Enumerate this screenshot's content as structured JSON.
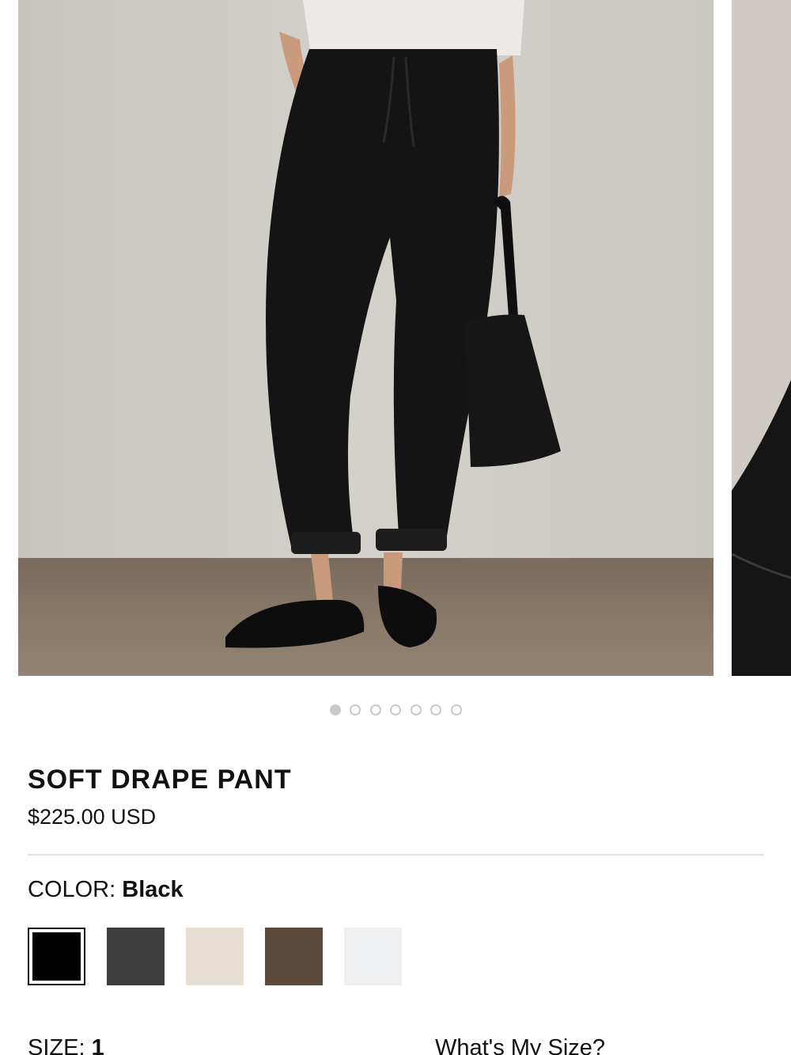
{
  "product": {
    "title": "SOFT DRAPE PANT",
    "price": "$225.00 USD"
  },
  "carousel": {
    "image_count": 7,
    "active_index": 0
  },
  "color": {
    "label": "COLOR:",
    "selected": "Black",
    "swatches": [
      {
        "name": "Black",
        "hex": "#000000",
        "selected": true
      },
      {
        "name": "Charcoal",
        "hex": "#3d3d3d",
        "selected": false
      },
      {
        "name": "Cream",
        "hex": "#e7ded3",
        "selected": false
      },
      {
        "name": "Brown",
        "hex": "#5b4a3b",
        "selected": false
      },
      {
        "name": "White",
        "hex": "#eff0f2",
        "selected": false
      }
    ]
  },
  "size": {
    "label": "SIZE:",
    "selected": "1",
    "guide_link": "What's My Size?"
  }
}
